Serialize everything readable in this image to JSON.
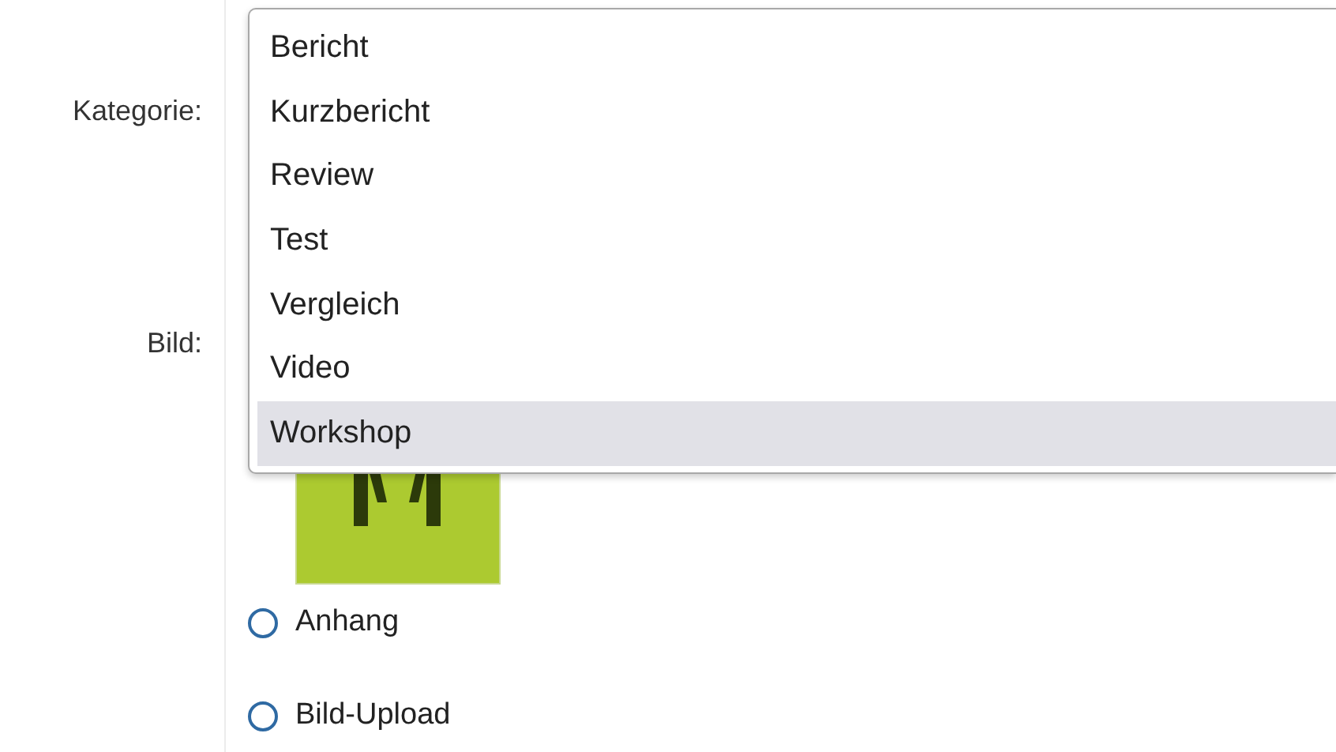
{
  "form_labels": [
    {
      "label": "Kategorie:"
    },
    {
      "label": "Bild:"
    }
  ],
  "category_dropdown": {
    "options": [
      {
        "label": "Bericht",
        "selected": false
      },
      {
        "label": "Kurzbericht",
        "selected": false
      },
      {
        "label": "Review",
        "selected": false
      },
      {
        "label": "Test",
        "selected": false
      },
      {
        "label": "Vergleich",
        "selected": false
      },
      {
        "label": "Video",
        "selected": false
      },
      {
        "label": "Workshop",
        "selected": true
      }
    ]
  },
  "image_source_options": [
    {
      "label": "Anhang",
      "selected": false
    },
    {
      "label": "Bild-Upload",
      "selected": false
    }
  ]
}
